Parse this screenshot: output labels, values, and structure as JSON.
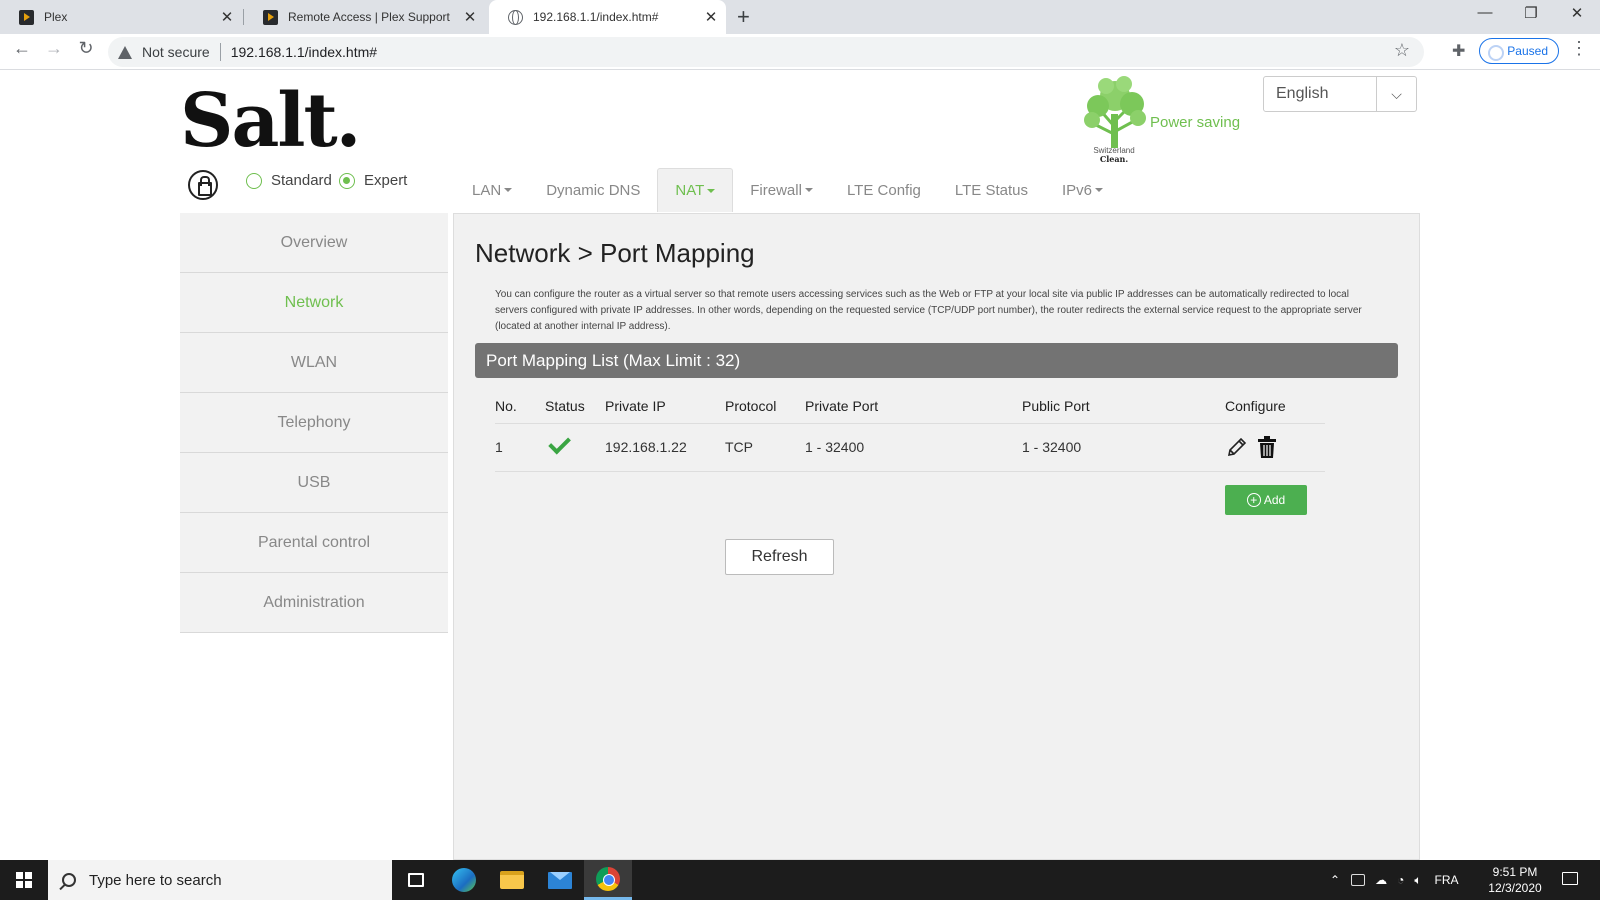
{
  "browser": {
    "tabs": [
      {
        "title": "Plex",
        "icon": "plex-icon",
        "active": false
      },
      {
        "title": "Remote Access | Plex Support",
        "icon": "plex-icon",
        "active": false
      },
      {
        "title": "192.168.1.1/index.htm#",
        "icon": "globe-icon",
        "active": true
      }
    ],
    "security_label": "Not secure",
    "url": "192.168.1.1/index.htm#",
    "profile_label": "Paused"
  },
  "header": {
    "logo_text": "Salt.",
    "tree_caption_line1": "Switzerland",
    "tree_caption_line2": "Clean.",
    "power_saving": "Power saving",
    "language": "English",
    "accent_color": "#6fbf4f"
  },
  "mode": {
    "standard_label": "Standard",
    "expert_label": "Expert",
    "selected": "Expert"
  },
  "topnav": {
    "items": [
      {
        "label": "LAN",
        "dropdown": true,
        "active": false
      },
      {
        "label": "Dynamic DNS",
        "dropdown": false,
        "active": false
      },
      {
        "label": "NAT",
        "dropdown": true,
        "active": true
      },
      {
        "label": "Firewall",
        "dropdown": true,
        "active": false
      },
      {
        "label": "LTE Config",
        "dropdown": false,
        "active": false
      },
      {
        "label": "LTE Status",
        "dropdown": false,
        "active": false
      },
      {
        "label": "IPv6",
        "dropdown": true,
        "active": false
      }
    ]
  },
  "sidebar": {
    "items": [
      {
        "label": "Overview",
        "active": false
      },
      {
        "label": "Network",
        "active": true
      },
      {
        "label": "WLAN",
        "active": false
      },
      {
        "label": "Telephony",
        "active": false
      },
      {
        "label": "USB",
        "active": false
      },
      {
        "label": "Parental control",
        "active": false
      },
      {
        "label": "Administration",
        "active": false
      }
    ]
  },
  "main": {
    "title": "Network > Port Mapping",
    "intro": "You can configure the router as a virtual server so that remote users accessing services such as the Web or FTP at your local site via public IP addresses can be automatically redirected to local servers configured with private IP addresses. In other words, depending on the requested service (TCP/UDP port number), the router redirects the external service request to the appropriate server (located at another internal IP address).",
    "list_header": "Port Mapping List (Max Limit : 32)",
    "columns": [
      "No.",
      "Status",
      "Private IP",
      "Protocol",
      "Private Port",
      "Public Port",
      "Configure"
    ],
    "rows": [
      {
        "no": "1",
        "status": "enabled",
        "private_ip": "192.168.1.22",
        "protocol": "TCP",
        "private_port": "1 - 32400",
        "public_port": "1 - 32400"
      }
    ],
    "add_label": "Add",
    "refresh_label": "Refresh"
  },
  "taskbar": {
    "search_placeholder": "Type here to search",
    "language": "FRA",
    "time": "9:51 PM",
    "date": "12/3/2020"
  }
}
